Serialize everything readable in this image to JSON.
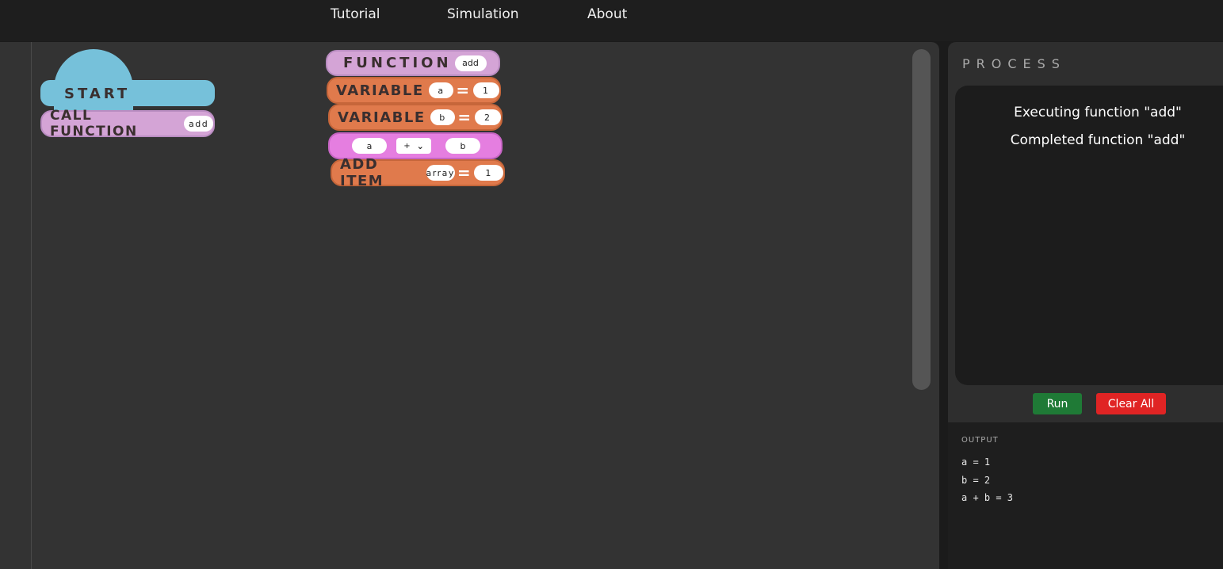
{
  "nav": {
    "links": [
      "Tutorial",
      "Simulation",
      "About"
    ]
  },
  "blocks": {
    "start": {
      "label": "START"
    },
    "call_function": {
      "label": "CALL FUNCTION",
      "value": "add"
    },
    "function": {
      "label": "FUNCTION",
      "value": "add"
    },
    "variable_a": {
      "label": "VARIABLE",
      "name": "a",
      "value": "1"
    },
    "variable_b": {
      "label": "VARIABLE",
      "name": "b",
      "value": "2"
    },
    "operation": {
      "left": "a",
      "operator": "+",
      "right": "b"
    },
    "add_item": {
      "label": "ADD ITEM",
      "name": "array",
      "value": "1"
    }
  },
  "panel": {
    "title": "PROCESS",
    "console_lines": [
      "Executing function \"add\"",
      "Completed function \"add\""
    ],
    "run_label": "Run",
    "clear_label": "Clear All",
    "output_label": "OUTPUT",
    "output_lines": [
      "a = 1",
      "b = 2",
      "a + b = 3"
    ]
  },
  "colors": {
    "start": "#76c1da",
    "function": "#d4a4d6",
    "variable": "#e07a4c",
    "operation": "#e57ee0",
    "run": "#1f7a36",
    "clear": "#e02424"
  }
}
